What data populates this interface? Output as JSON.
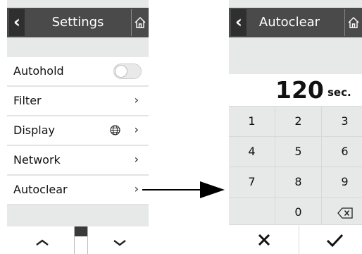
{
  "settings": {
    "title": "Settings",
    "items": [
      {
        "label": "Autohold",
        "control": "toggle",
        "toggle_on": false
      },
      {
        "label": "Filter",
        "control": "chevron"
      },
      {
        "label": "Display",
        "control": "chevron",
        "icon": "globe-icon"
      },
      {
        "label": "Network",
        "control": "chevron"
      },
      {
        "label": "Autoclear",
        "control": "chevron"
      }
    ],
    "scroll_position_fraction": 0.0
  },
  "autoclear": {
    "title": "Autoclear",
    "value": "120",
    "unit": "sec.",
    "keys": [
      [
        "1",
        "2",
        "3"
      ],
      [
        "4",
        "5",
        "6"
      ],
      [
        "7",
        "8",
        "9"
      ],
      [
        "",
        "0",
        "backspace-icon"
      ]
    ]
  },
  "icons": {
    "back": "‹",
    "chevron": "›",
    "cancel": "✕",
    "confirm": "✓"
  },
  "colors": {
    "titlebar": "#4a4a4a",
    "back_button": "#2f2f2f",
    "screen_bg": "#e7e9e8",
    "item_bg": "#ffffff"
  }
}
